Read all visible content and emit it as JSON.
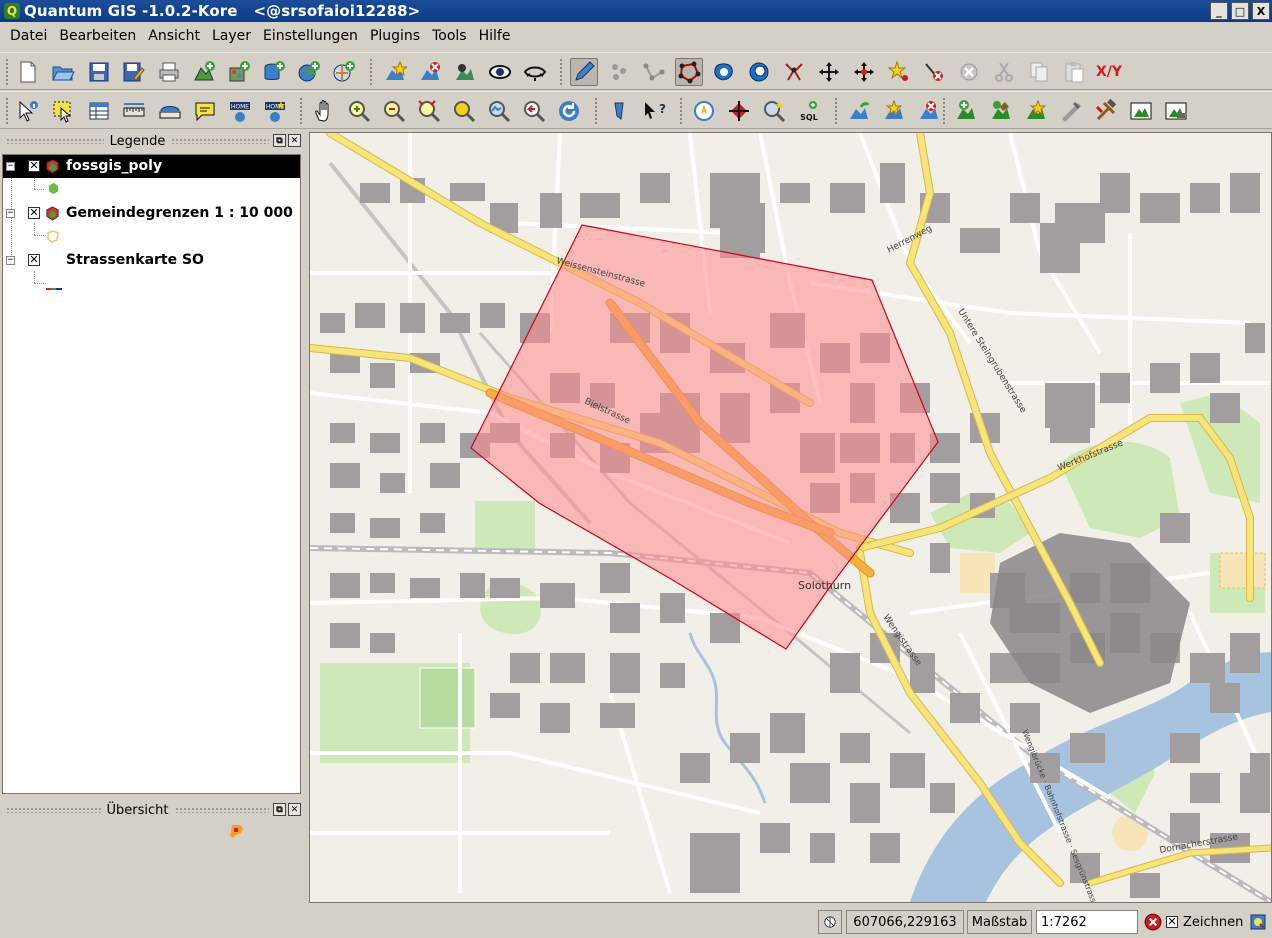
{
  "window": {
    "title": "Quantum GIS -1.0.2-Kore   <@srsofaioi12288>",
    "app_icon": "qgis-icon",
    "buttons": {
      "minimize": "_",
      "maximize": "□",
      "close": "X"
    }
  },
  "menu": [
    {
      "id": "datei",
      "label": "Datei"
    },
    {
      "id": "bearbeiten",
      "label": "Bearbeiten"
    },
    {
      "id": "ansicht",
      "label": "Ansicht"
    },
    {
      "id": "layer",
      "label": "Layer"
    },
    {
      "id": "einstellungen",
      "label": "Einstellungen"
    },
    {
      "id": "plugins",
      "label": "Plugins"
    },
    {
      "id": "tools",
      "label": "Tools"
    },
    {
      "id": "hilfe",
      "label": "Hilfe"
    }
  ],
  "toolbar1": {
    "xy_label": "X/Y",
    "icons": [
      "new-project-icon",
      "open-project-icon",
      "save-project-icon",
      "save-as-icon",
      "print-icon",
      "add-vector-icon",
      "add-raster-icon",
      "add-postgis-icon",
      "add-wms-icon",
      "add-wfs-icon",
      "new-layer-icon",
      "remove-layer-icon",
      "add-all-icon",
      "show-all-icon",
      "hide-all-icon",
      "toggle-editing-icon",
      "capture-point-icon",
      "capture-line-icon",
      "capture-polygon-icon",
      "add-ring-icon",
      "add-island-icon",
      "move-feature-icon",
      "split-icon",
      "move-vertex-icon",
      "add-vertex-icon",
      "delete-vertex-icon",
      "delete-selected-icon",
      "cut-icon",
      "copy-icon",
      "paste-icon",
      "coordinate-capture-icon"
    ]
  },
  "toolbar2": {
    "icons": [
      "identify-icon",
      "select-icon",
      "attribute-table-icon",
      "measure-line-icon",
      "measure-area-icon",
      "map-tips-icon",
      "home-icon",
      "home-plus-icon",
      "pan-icon",
      "zoom-in-icon",
      "zoom-out-icon",
      "zoom-full-icon",
      "zoom-selection-icon",
      "zoom-layer-icon",
      "zoom-last-icon",
      "refresh-icon",
      "bookmark-icon",
      "whats-this-icon",
      "north-arrow-icon",
      "gps-icon",
      "query-icon",
      "sql-icon",
      "add-wfs-layer-icon",
      "new-point-layer-icon",
      "remove-point-icon",
      "add-raster-layer-icon",
      "add-vector-layer-icon",
      "georeferencer-icon",
      "grass-icon",
      "grass-tools-icon",
      "new-mapset-icon",
      "close-mapset-icon"
    ]
  },
  "legend": {
    "title": "Legende",
    "layers": [
      {
        "name": "fossgis_poly",
        "checked": "✕",
        "symbol": "polygon-green-icon",
        "selected": true
      },
      {
        "name": "Gemeindegrenzen 1 : 10 000",
        "checked": "✕",
        "symbol": "polygon-outline-orange-icon",
        "selected": false
      },
      {
        "name": "Strassenkarte SO",
        "checked": "✕",
        "symbol": "raster-rgb-icon",
        "selected": false
      }
    ],
    "colors": {
      "fossgis_poly": "#6bbf3a",
      "gemeindegrenzen": "#f5c463"
    }
  },
  "overview": {
    "title": "Übersicht"
  },
  "map": {
    "labels": {
      "weissensteinstrasse": "Weissensteinstrasse",
      "bielstrasse": "Bielstrasse",
      "herrenweg": "Herrenweg",
      "untere_steingrubenstrasse": "Untere Steingrubenstrasse",
      "werkhofstrasse": "Werkhofstrasse",
      "solothurn": "Solothurn",
      "wengistrasse": "Wengistrasse",
      "wengibruecke": "Wengibrücke · Bahnhofstrasse · Sesgrünstrasse",
      "dornacherstrasse": "Dornacherstrasse"
    },
    "colors": {
      "background": "#f2efe9",
      "building": "#a29ea0",
      "road_major": "#f7e47a",
      "road_primary": "#f5b13c",
      "water": "#a8c3e0",
      "park": "#cfe8b8",
      "selection_fill": "#ff8a8c",
      "selection_stroke": "#d0001e"
    }
  },
  "statusbar": {
    "coordinates": "607066,229163",
    "scale_label": "Maßstab",
    "scale_value": "1:7262",
    "render_label": "Zeichnen",
    "render_checked": "✕"
  }
}
